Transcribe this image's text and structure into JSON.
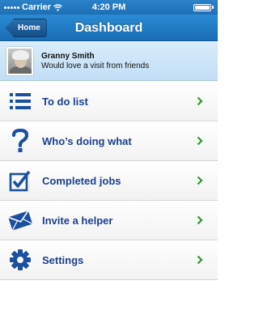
{
  "status_bar": {
    "carrier": "Carrier",
    "time": "4:20 PM",
    "battery_level": 1.0,
    "icons": [
      "signal-icon",
      "wifi-icon",
      "battery-icon"
    ]
  },
  "nav_bar": {
    "back_label": "Home",
    "title": "Dashboard"
  },
  "profile": {
    "name": "Granny Smith",
    "status": "Would love a visit from friends"
  },
  "menu": {
    "items": [
      {
        "label": "To do list",
        "icon": "list-icon"
      },
      {
        "label": "Who’s doing what",
        "icon": "question-icon"
      },
      {
        "label": "Completed jobs",
        "icon": "checkbox-icon"
      },
      {
        "label": "Invite a helper",
        "icon": "envelope-icon"
      },
      {
        "label": "Settings",
        "icon": "gear-icon"
      }
    ],
    "chevron_icon": "chevron-right-icon"
  },
  "colors": {
    "accent": "#1f6fb4",
    "label": "#1b3f8f",
    "chevron": "#2e9a2e"
  }
}
